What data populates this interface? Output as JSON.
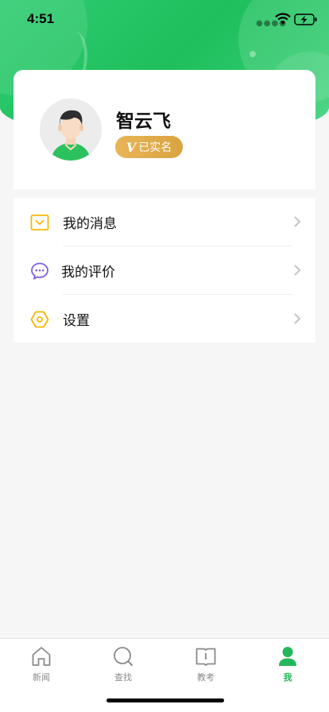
{
  "status_bar": {
    "time": "4:51"
  },
  "profile": {
    "name": "智云飞",
    "verify_mark": "V",
    "verify_text": "已实名"
  },
  "menu": {
    "items": [
      {
        "label": "我的消息",
        "icon": "envelope-icon"
      },
      {
        "label": "我的评价",
        "icon": "chat-bubble-icon"
      },
      {
        "label": "设置",
        "icon": "settings-hexagon-icon"
      }
    ]
  },
  "tabbar": {
    "tabs": [
      {
        "label": "新闻",
        "icon": "home-icon"
      },
      {
        "label": "查找",
        "icon": "search-icon"
      },
      {
        "label": "教考",
        "icon": "book-icon"
      },
      {
        "label": "我",
        "icon": "user-icon",
        "active": true
      }
    ]
  },
  "colors": {
    "brand_green": "#22b85a",
    "badge_gold": "#e0ab4a",
    "icon_yellow": "#f5b800",
    "icon_purple": "#7b61e8"
  }
}
